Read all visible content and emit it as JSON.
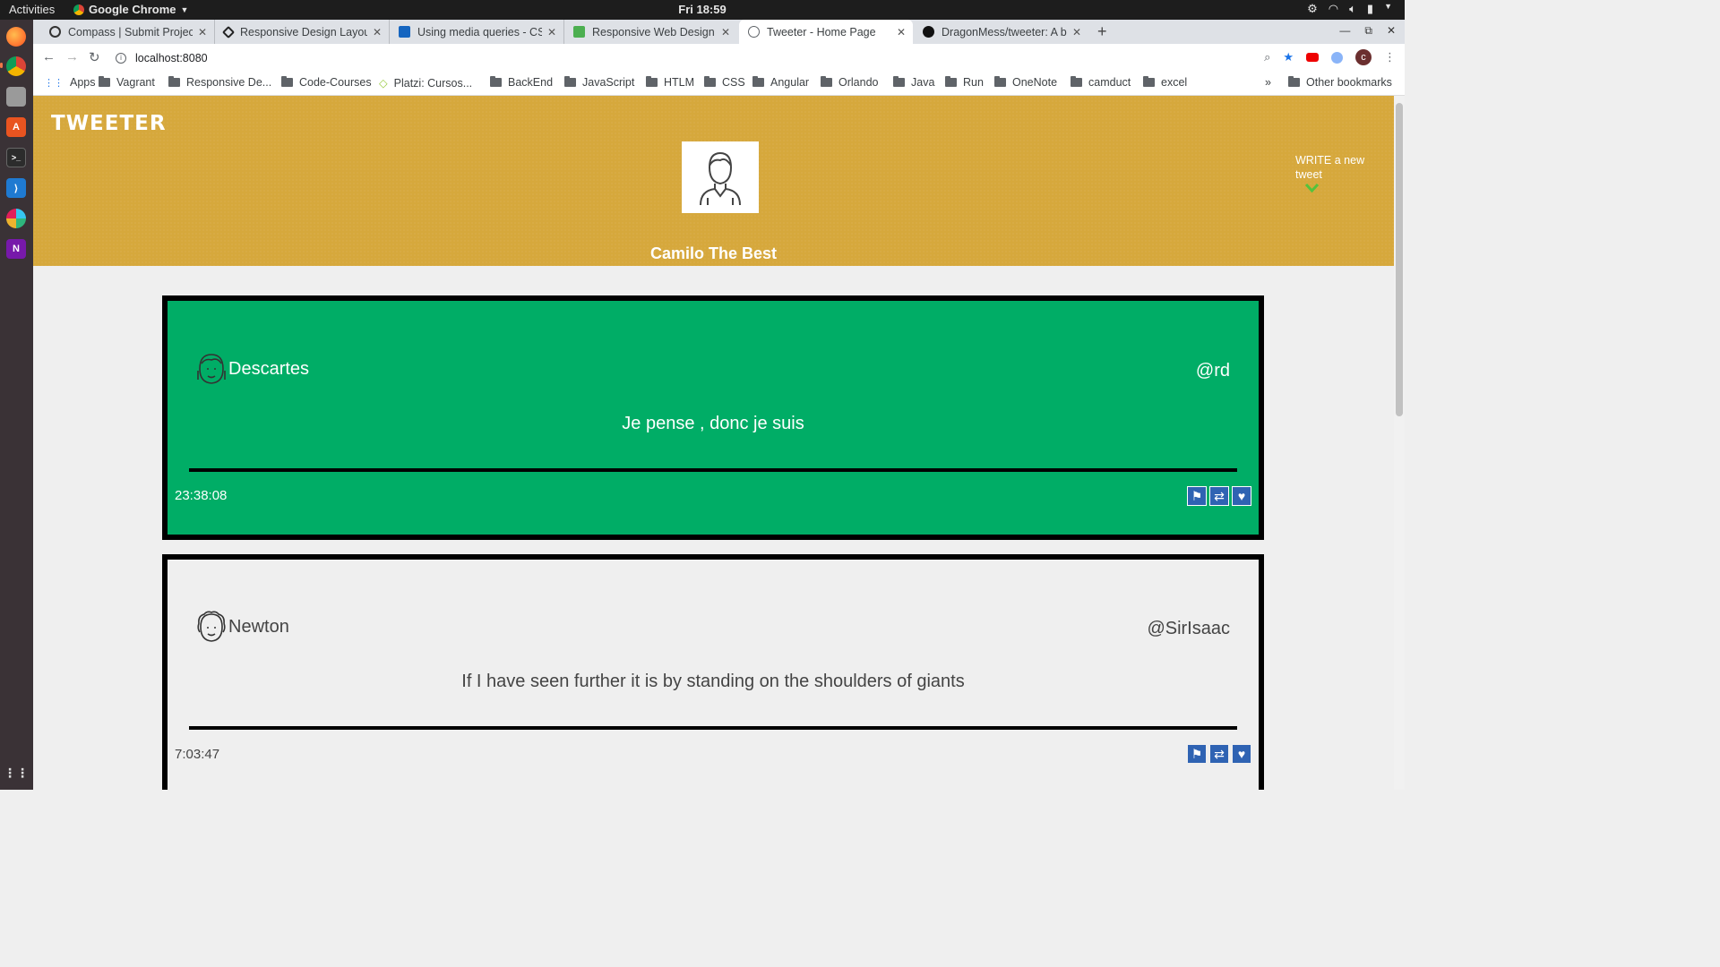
{
  "os": {
    "activities_label": "Activities",
    "app_name": "Google Chrome",
    "clock": "Fri 18:59"
  },
  "browser": {
    "tabs": [
      {
        "title": "Compass | Submit Project",
        "active": false
      },
      {
        "title": "Responsive Design Layout",
        "active": false
      },
      {
        "title": "Using media queries - CSS",
        "active": false
      },
      {
        "title": "Responsive Web Design V",
        "active": false
      },
      {
        "title": "Tweeter - Home Page",
        "active": true
      },
      {
        "title": "DragonMess/tweeter: A b",
        "active": false
      }
    ],
    "url": "localhost:8080",
    "profile_initial": "c",
    "bookmarks": [
      "Apps",
      "Vagrant",
      "Responsive De...",
      "Code-Courses",
      "Platzi: Cursos...",
      "BackEnd",
      "JavaScript",
      "HTLM",
      "CSS",
      "Angular",
      "Orlando",
      "Java",
      "Run",
      "OneNote",
      "camduct",
      "excel"
    ],
    "other_bookmarks": "Other bookmarks",
    "overflow": "»"
  },
  "page": {
    "brand": "TWEETER",
    "user_name": "Camilo The Best",
    "compose_label": "WRITE a new tweet",
    "accent_color": "#d6a83c",
    "tweets": [
      {
        "name": "Descartes",
        "handle": "@rd",
        "content": "Je pense , donc je suis",
        "time": "23:38:08"
      },
      {
        "name": "Newton",
        "handle": "@SirIsaac",
        "content": "If I have seen further it is by standing on the shoulders of giants",
        "time": "7:03:47"
      }
    ]
  }
}
